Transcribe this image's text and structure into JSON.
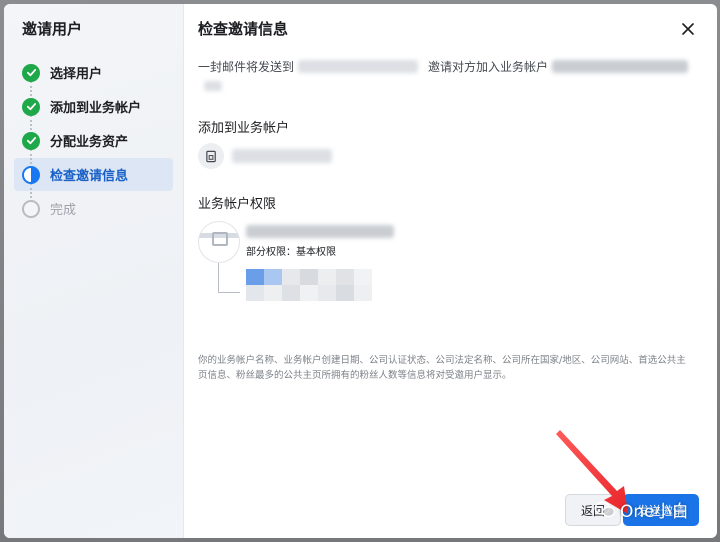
{
  "sidebar": {
    "title": "邀请用户",
    "steps": [
      {
        "label": "选择用户",
        "state": "done"
      },
      {
        "label": "添加到业务帐户",
        "state": "done"
      },
      {
        "label": "分配业务资产",
        "state": "done"
      },
      {
        "label": "检查邀请信息",
        "state": "current"
      },
      {
        "label": "完成",
        "state": "todo"
      }
    ]
  },
  "main": {
    "title": "检查邀请信息",
    "email_prefix": "一封邮件将发送到",
    "invite_text": "邀请对方加入业务帐户",
    "added_label": "添加到业务帐户",
    "perm_label": "业务帐户权限",
    "perm_sub": "部分权限：基本权限",
    "disclaimer": "你的业务帐户名称、业务帐户创建日期、公司认证状态、公司法定名称、公司所在国家/地区、公司网站、首选公共主页信息、粉丝最多的公共主页所拥有的粉丝人数等信息将对受邀用户显示。"
  },
  "footer": {
    "back_label": "返回",
    "send_label": "发送邀请"
  },
  "watermark": {
    "text": "One小白"
  },
  "colors": {
    "accent": "#1a74e8",
    "done": "#1fa84a",
    "annotation_arrow": "#e8262b"
  },
  "icons": {
    "close": "close-icon",
    "done": "check-circle-icon",
    "current": "half-circle-icon",
    "todo": "empty-circle-icon",
    "account": "business-account-icon",
    "wechat": "wechat-icon"
  }
}
